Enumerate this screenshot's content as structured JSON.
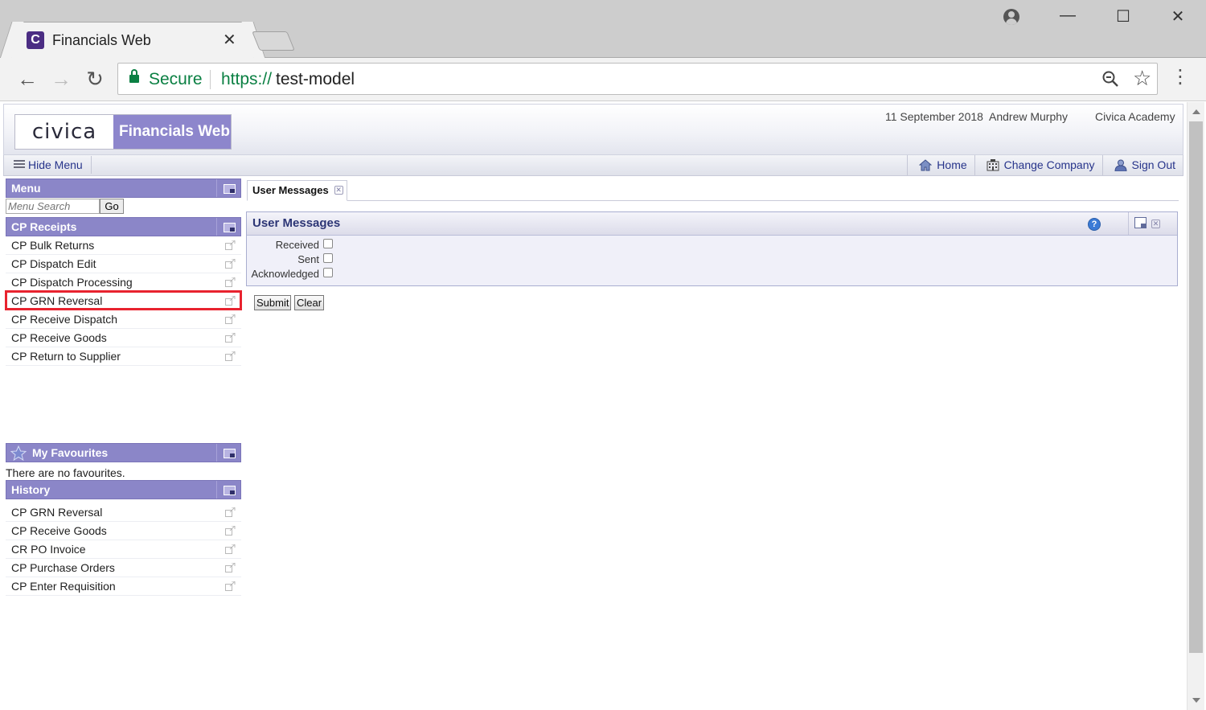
{
  "browser": {
    "tab_title": "Financials Web",
    "favicon_letter": "C",
    "secure_label": "Secure",
    "url_scheme": "https://",
    "url_host": "test-model"
  },
  "header": {
    "logo_brand": "civica",
    "logo_product": "Financials Web",
    "date": "11 September 2018",
    "user": "Andrew Murphy",
    "company": "Civica Academy"
  },
  "toolbar": {
    "hide_menu": "Hide Menu",
    "home": "Home",
    "change_company": "Change Company",
    "sign_out": "Sign Out"
  },
  "sidebar": {
    "menu_title": "Menu",
    "search_placeholder": "Menu Search",
    "go_label": "Go",
    "section_title": "CP Receipts",
    "items": [
      {
        "label": "CP Bulk Returns"
      },
      {
        "label": "CP Dispatch Edit"
      },
      {
        "label": "CP Dispatch Processing"
      },
      {
        "label": "CP GRN Reversal",
        "highlighted": true
      },
      {
        "label": "CP Receive Dispatch"
      },
      {
        "label": "CP Receive Goods"
      },
      {
        "label": "CP Return to Supplier"
      }
    ],
    "favourites_title": "My Favourites",
    "no_favourites": "There are no favourites.",
    "history_title": "History",
    "history": [
      {
        "label": "CP GRN Reversal"
      },
      {
        "label": "CP Receive Goods"
      },
      {
        "label": "CR PO Invoice"
      },
      {
        "label": "CP Purchase Orders"
      },
      {
        "label": "CP Enter Requisition"
      }
    ]
  },
  "main": {
    "tab_label": "User Messages",
    "panel_title": "User Messages",
    "help_icon": "?",
    "fields": [
      {
        "label": "Received",
        "checked": false
      },
      {
        "label": "Sent",
        "checked": false
      },
      {
        "label": "Acknowledged",
        "checked": false
      }
    ],
    "submit_label": "Submit",
    "clear_label": "Clear"
  },
  "colors": {
    "accent": "#8b86c8",
    "link": "#27348b",
    "highlight": "#e8232f",
    "secure": "#0b8043"
  },
  "icons": [
    "profile-icon",
    "minimize-icon",
    "maximize-icon",
    "close-icon",
    "back-icon",
    "forward-icon",
    "reload-icon",
    "lock-icon",
    "zoom-icon",
    "star-icon",
    "menu-dots-icon",
    "hide-menu-icon",
    "home-icon",
    "building-icon",
    "sign-out-icon",
    "panel-toggle-icon",
    "external-link-icon",
    "favourites-star-icon",
    "help-icon",
    "popout-icon",
    "close-tab-icon"
  ]
}
